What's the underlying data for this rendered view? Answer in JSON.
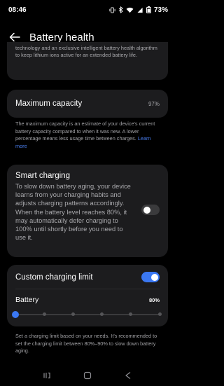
{
  "status": {
    "time": "08:46",
    "battery": "73%"
  },
  "header": {
    "title": "Battery health"
  },
  "intro": {
    "text": "technology and an exclusive intelligent battery health algorithm to keep lithium ions active for an extended battery life."
  },
  "capacity": {
    "label": "Maximum capacity",
    "value": "97%",
    "description": "The maximum capacity is an estimate of your device's current battery capacity compared to when it was new. A lower percentage means less usage time between charges.",
    "link": "Learn more"
  },
  "smart_charging": {
    "title": "Smart charging",
    "description": "To slow down battery aging, your device learns from your charging habits and adjusts charging patterns accordingly. When the battery level reaches 80%, it may automatically defer charging to 100% until shortly before you need to use it.",
    "enabled": false
  },
  "custom_limit": {
    "title": "Custom charging limit",
    "enabled": true,
    "battery_label": "Battery",
    "battery_value": "80%",
    "slider_fraction": 0.0,
    "slider_steps": 6,
    "description": "Set a charging limit based on your needs. It's recommended to set the charging limit between 80%–90% to slow down battery aging."
  },
  "colors": {
    "accent": "#3b78f2",
    "card": "#1c1c1e",
    "link": "#4a7ff0"
  }
}
